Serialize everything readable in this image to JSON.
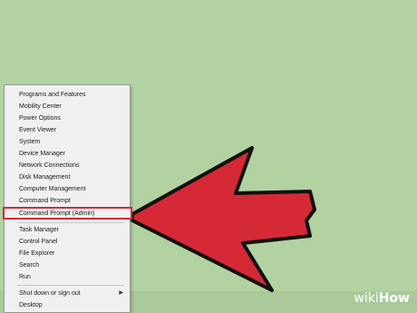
{
  "menu": {
    "items": [
      "Programs and Features",
      "Mobility Center",
      "Power Options",
      "Event Viewer",
      "System",
      "Device Manager",
      "Network Connections",
      "Disk Management",
      "Computer Management",
      "Command Prompt",
      "Command Prompt (Admin)",
      "Task Manager",
      "Control Panel",
      "File Explorer",
      "Search",
      "Run",
      "Shut down or sign out",
      "Desktop"
    ],
    "highlighted_item": "Command Prompt (Admin)",
    "submenu_item": "Shut down or sign out"
  },
  "colors": {
    "desktop": "#b2d3a1",
    "arrow": "#d52a36",
    "highlight_border": "#d52a36"
  },
  "icons": {
    "submenu": "chevron-right-icon",
    "pointer": "red-arrow-icon"
  },
  "watermark": {
    "wiki": "wiki",
    "how": "How"
  }
}
